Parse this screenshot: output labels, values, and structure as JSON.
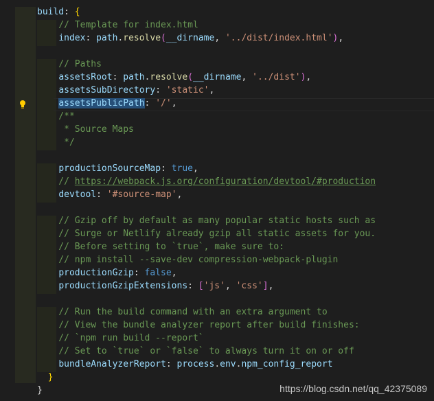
{
  "editor": {
    "lines": [
      {
        "tokens": [
          {
            "t": "build",
            "c": "key"
          },
          {
            "t": ": ",
            "c": "pl"
          },
          {
            "t": "{",
            "c": "br"
          }
        ]
      },
      {
        "tokens": [
          {
            "t": "    // Template for index.html",
            "c": "com"
          }
        ]
      },
      {
        "tokens": [
          {
            "t": "    ",
            "c": "pl"
          },
          {
            "t": "index",
            "c": "key"
          },
          {
            "t": ": ",
            "c": "pl"
          },
          {
            "t": "path",
            "c": "key"
          },
          {
            "t": ".",
            "c": "pl"
          },
          {
            "t": "resolve",
            "c": "fn"
          },
          {
            "t": "(",
            "c": "br2"
          },
          {
            "t": "__dirname",
            "c": "key"
          },
          {
            "t": ", ",
            "c": "pl"
          },
          {
            "t": "'../dist/index.html'",
            "c": "str"
          },
          {
            "t": ")",
            "c": "br2"
          },
          {
            "t": ",",
            "c": "pl"
          }
        ]
      },
      {
        "tokens": []
      },
      {
        "tokens": [
          {
            "t": "    // Paths",
            "c": "com"
          }
        ]
      },
      {
        "tokens": [
          {
            "t": "    ",
            "c": "pl"
          },
          {
            "t": "assetsRoot",
            "c": "key"
          },
          {
            "t": ": ",
            "c": "pl"
          },
          {
            "t": "path",
            "c": "key"
          },
          {
            "t": ".",
            "c": "pl"
          },
          {
            "t": "resolve",
            "c": "fn"
          },
          {
            "t": "(",
            "c": "br2"
          },
          {
            "t": "__dirname",
            "c": "key"
          },
          {
            "t": ", ",
            "c": "pl"
          },
          {
            "t": "'../dist'",
            "c": "str"
          },
          {
            "t": ")",
            "c": "br2"
          },
          {
            "t": ",",
            "c": "pl"
          }
        ]
      },
      {
        "tokens": [
          {
            "t": "    ",
            "c": "pl"
          },
          {
            "t": "assetsSubDirectory",
            "c": "key"
          },
          {
            "t": ": ",
            "c": "pl"
          },
          {
            "t": "'static'",
            "c": "str"
          },
          {
            "t": ",",
            "c": "pl"
          }
        ]
      },
      {
        "tokens": [
          {
            "t": "    ",
            "c": "pl"
          },
          {
            "t": "assetsPublicPath",
            "c": "key",
            "sel": true
          },
          {
            "t": ": ",
            "c": "pl"
          },
          {
            "t": "'/'",
            "c": "str"
          },
          {
            "t": ",",
            "c": "pl"
          }
        ]
      },
      {
        "tokens": [
          {
            "t": "    /**",
            "c": "com"
          }
        ]
      },
      {
        "tokens": [
          {
            "t": "     * Source Maps",
            "c": "com"
          }
        ]
      },
      {
        "tokens": [
          {
            "t": "     */",
            "c": "com"
          }
        ]
      },
      {
        "tokens": []
      },
      {
        "tokens": [
          {
            "t": "    ",
            "c": "pl"
          },
          {
            "t": "productionSourceMap",
            "c": "key"
          },
          {
            "t": ": ",
            "c": "pl"
          },
          {
            "t": "true",
            "c": "kw"
          },
          {
            "t": ",",
            "c": "pl"
          }
        ]
      },
      {
        "tokens": [
          {
            "t": "    // ",
            "c": "com"
          },
          {
            "t": "https://webpack.js.org/configuration/devtool/#production",
            "c": "link"
          }
        ]
      },
      {
        "tokens": [
          {
            "t": "    ",
            "c": "pl"
          },
          {
            "t": "devtool",
            "c": "key"
          },
          {
            "t": ": ",
            "c": "pl"
          },
          {
            "t": "'#source-map'",
            "c": "str"
          },
          {
            "t": ",",
            "c": "pl"
          }
        ]
      },
      {
        "tokens": []
      },
      {
        "tokens": [
          {
            "t": "    // Gzip off by default as many popular static hosts such as",
            "c": "com"
          }
        ]
      },
      {
        "tokens": [
          {
            "t": "    // Surge or Netlify already gzip all static assets for you.",
            "c": "com"
          }
        ]
      },
      {
        "tokens": [
          {
            "t": "    // Before setting to `true`, make sure to:",
            "c": "com"
          }
        ]
      },
      {
        "tokens": [
          {
            "t": "    // npm install --save-dev compression-webpack-plugin",
            "c": "com"
          }
        ]
      },
      {
        "tokens": [
          {
            "t": "    ",
            "c": "pl"
          },
          {
            "t": "productionGzip",
            "c": "key"
          },
          {
            "t": ": ",
            "c": "pl"
          },
          {
            "t": "false",
            "c": "kw"
          },
          {
            "t": ",",
            "c": "pl"
          }
        ]
      },
      {
        "tokens": [
          {
            "t": "    ",
            "c": "pl"
          },
          {
            "t": "productionGzipExtensions",
            "c": "key"
          },
          {
            "t": ": ",
            "c": "pl"
          },
          {
            "t": "[",
            "c": "br2"
          },
          {
            "t": "'js'",
            "c": "str"
          },
          {
            "t": ", ",
            "c": "pl"
          },
          {
            "t": "'css'",
            "c": "str"
          },
          {
            "t": "]",
            "c": "br2"
          },
          {
            "t": ",",
            "c": "pl"
          }
        ]
      },
      {
        "tokens": []
      },
      {
        "tokens": [
          {
            "t": "    // Run the build command with an extra argument to",
            "c": "com"
          }
        ]
      },
      {
        "tokens": [
          {
            "t": "    // View the bundle analyzer report after build finishes:",
            "c": "com"
          }
        ]
      },
      {
        "tokens": [
          {
            "t": "    // `npm run build --report`",
            "c": "com"
          }
        ]
      },
      {
        "tokens": [
          {
            "t": "    // Set to `true` or `false` to always turn it on or off",
            "c": "com"
          }
        ]
      },
      {
        "tokens": [
          {
            "t": "    ",
            "c": "pl"
          },
          {
            "t": "bundleAnalyzerReport",
            "c": "key"
          },
          {
            "t": ": ",
            "c": "pl"
          },
          {
            "t": "process",
            "c": "key"
          },
          {
            "t": ".",
            "c": "pl"
          },
          {
            "t": "env",
            "c": "key"
          },
          {
            "t": ".",
            "c": "pl"
          },
          {
            "t": "npm_config_report",
            "c": "key"
          }
        ]
      },
      {
        "tokens": [
          {
            "t": "  ",
            "c": "pl"
          },
          {
            "t": "}",
            "c": "br"
          }
        ]
      },
      {
        "tokens": [
          {
            "t": "}",
            "c": "pl"
          }
        ]
      }
    ]
  },
  "lightbulb_icon": "lightbulb-icon",
  "watermark": "https://blog.csdn.net/qq_42375089",
  "colors": {
    "background": "#1e1e1e",
    "key": "#9cdcfe",
    "string": "#ce9178",
    "comment": "#6a9955",
    "keyword": "#569cd6",
    "function": "#dcdcaa",
    "selection": "#264f78",
    "lightbulb": "#ffcc00"
  }
}
